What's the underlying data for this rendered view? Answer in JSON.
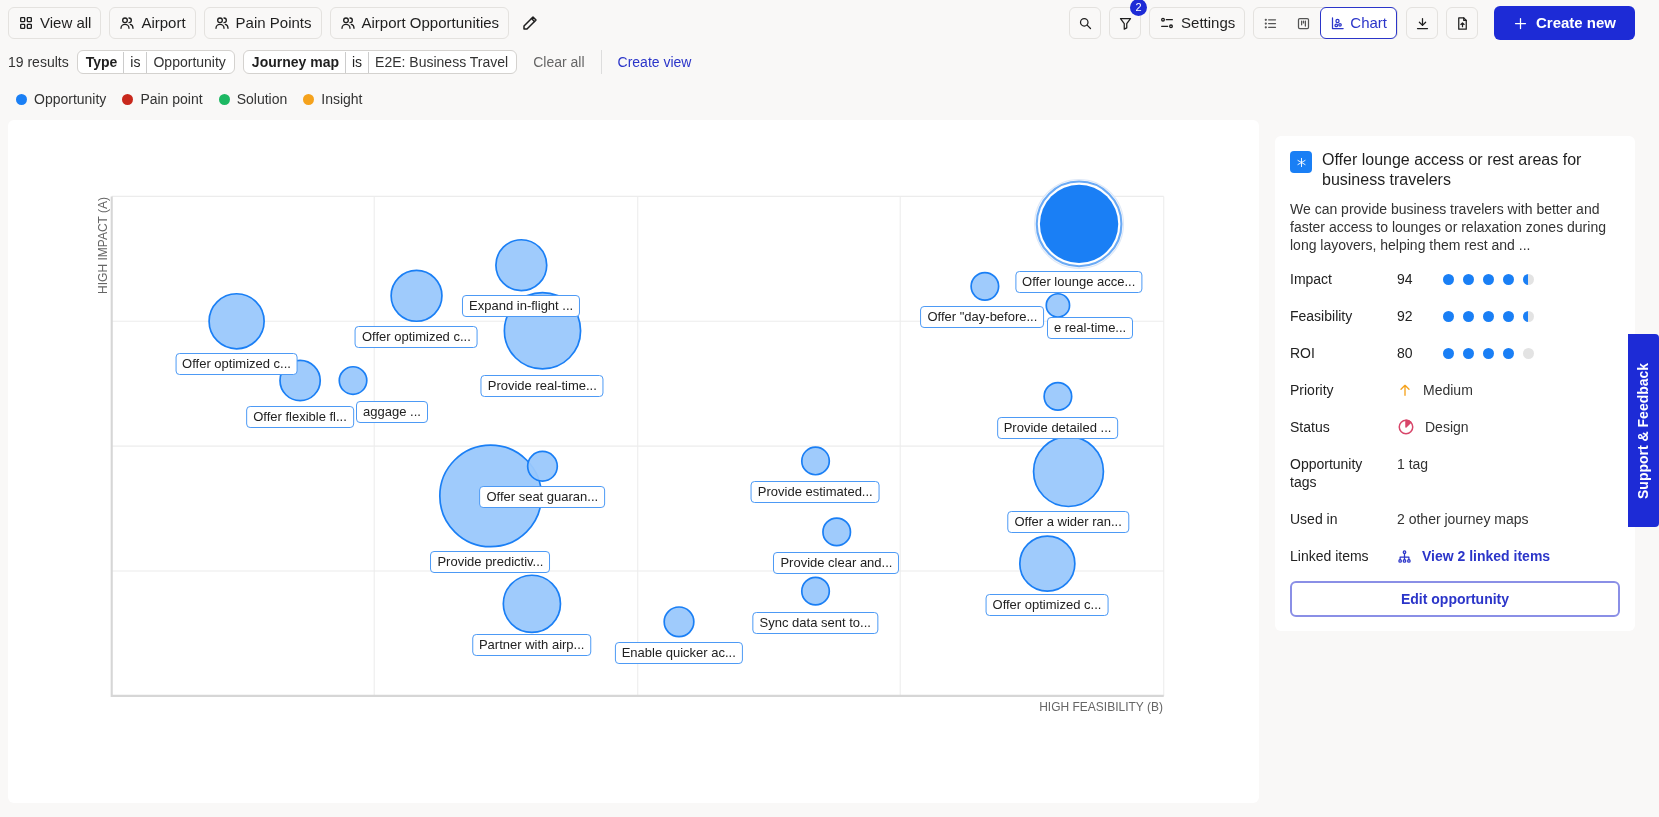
{
  "toolbar": {
    "views": [
      {
        "label": "View all",
        "kind": "grid"
      },
      {
        "label": "Airport",
        "kind": "group"
      },
      {
        "label": "Pain Points",
        "kind": "group"
      },
      {
        "label": "Airport Opportunities",
        "kind": "group"
      }
    ],
    "filter_count": "2",
    "settings": "Settings",
    "view_modes": [
      {
        "kind": "list",
        "selected": false
      },
      {
        "kind": "board",
        "selected": false
      },
      {
        "kind": "chart",
        "label": "Chart",
        "selected": true
      }
    ],
    "create_button": "Create new"
  },
  "filters": {
    "results": "19 results",
    "chips": [
      {
        "field": "Type",
        "operator": "is",
        "value": "Opportunity"
      },
      {
        "field": "Journey map",
        "operator": "is",
        "value": "E2E: Business Travel"
      }
    ],
    "clear": "Clear all",
    "create_view": "Create view"
  },
  "legend": [
    {
      "label": "Opportunity",
      "color": "#1a7ff5"
    },
    {
      "label": "Pain point",
      "color": "#c8281c"
    },
    {
      "label": "Solution",
      "color": "#1db863"
    },
    {
      "label": "Insight",
      "color": "#f5a21c"
    }
  ],
  "chart": {
    "ylabel": "HIGH IMPACT (A)",
    "xlabel": "HIGH FEASIBILITY (B)",
    "bubbles": [
      {
        "label": "Offer optimized c...",
        "selected": false
      },
      {
        "label": "Offer flexible fl...",
        "selected": false
      },
      {
        "label": "aggage ...",
        "selected": false
      },
      {
        "label": "Offer optimized c...",
        "selected": false
      },
      {
        "label": "Expand in-flight ...",
        "selected": false
      },
      {
        "label": "Provide real-time...",
        "selected": false
      },
      {
        "label": "Provide predictiv...",
        "selected": false
      },
      {
        "label": "Offer seat guaran...",
        "selected": false
      },
      {
        "label": "Partner with airp...",
        "selected": false
      },
      {
        "label": "Enable quicker ac...",
        "selected": false
      },
      {
        "label": "Provide estimated...",
        "selected": false
      },
      {
        "label": "Provide clear and...",
        "selected": false
      },
      {
        "label": "Sync data sent to...",
        "selected": false
      },
      {
        "label": "Offer lounge acce...",
        "selected": true
      },
      {
        "label": "Offer \"day-before...",
        "selected": false
      },
      {
        "label": "e real-time...",
        "selected": false
      },
      {
        "label": "Provide detailed ...",
        "selected": false
      },
      {
        "label": "Offer a wider ran...",
        "selected": false
      },
      {
        "label": "Offer optimized c...",
        "selected": false
      }
    ]
  },
  "detail": {
    "title": "Offer lounge access or rest areas for business travelers",
    "description": "We can provide business travelers with better and faster access to lounges or relaxation zones during long layovers, helping them rest and ...",
    "scores": [
      {
        "label": "Impact",
        "value": "94",
        "stars": 4.5
      },
      {
        "label": "Feasibility",
        "value": "92",
        "stars": 4.5
      },
      {
        "label": "ROI",
        "value": "80",
        "stars": 4
      }
    ],
    "fields": [
      {
        "kind": "priority",
        "label": "Priority",
        "value": "Medium"
      },
      {
        "kind": "status",
        "label": "Status",
        "value": "Design"
      },
      {
        "kind": "text",
        "label": "Opportunity tags",
        "value": "1 tag"
      },
      {
        "kind": "text",
        "label": "Used in",
        "value": "2 other journey maps"
      },
      {
        "kind": "link",
        "label": "Linked items",
        "value": "View 2 linked items"
      }
    ],
    "edit_button": "Edit opportunity"
  },
  "support_tab": "Support & Feedback"
}
